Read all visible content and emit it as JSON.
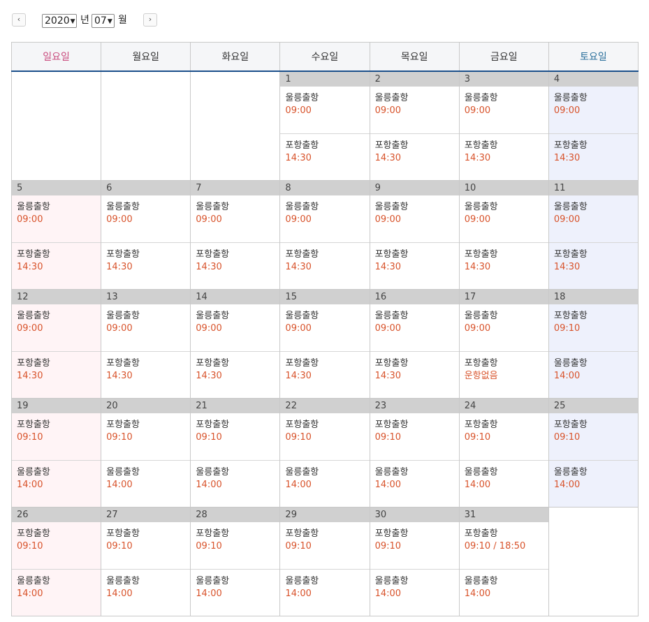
{
  "toolbar": {
    "prev_label": "‹",
    "next_label": "›",
    "year_value": "2020",
    "year_unit": "년",
    "month_value": "07",
    "month_unit": "월"
  },
  "weekdays": [
    "일요일",
    "월요일",
    "화요일",
    "수요일",
    "목요일",
    "금요일",
    "토요일"
  ],
  "colors": {
    "sunday_text": "#c94b7d",
    "saturday_text": "#2a6f9b",
    "time_text": "#d8532b",
    "header_underline": "#1b4f8a",
    "day_bar": "#d0d0d0",
    "sunday_bg": "#fff4f6",
    "saturday_bg": "#eef1fc"
  },
  "weeks": [
    [
      null,
      null,
      null,
      {
        "day": "1",
        "slots": [
          {
            "route": "울릉출항",
            "time": "09:00"
          },
          {
            "route": "포항출항",
            "time": "14:30"
          }
        ]
      },
      {
        "day": "2",
        "slots": [
          {
            "route": "울릉출항",
            "time": "09:00"
          },
          {
            "route": "포항출항",
            "time": "14:30"
          }
        ]
      },
      {
        "day": "3",
        "slots": [
          {
            "route": "울릉출항",
            "time": "09:00"
          },
          {
            "route": "포항출항",
            "time": "14:30"
          }
        ]
      },
      {
        "day": "4",
        "slots": [
          {
            "route": "울릉출항",
            "time": "09:00"
          },
          {
            "route": "포항출항",
            "time": "14:30"
          }
        ]
      }
    ],
    [
      {
        "day": "5",
        "slots": [
          {
            "route": "울릉출항",
            "time": "09:00"
          },
          {
            "route": "포항출항",
            "time": "14:30"
          }
        ]
      },
      {
        "day": "6",
        "slots": [
          {
            "route": "울릉출항",
            "time": "09:00"
          },
          {
            "route": "포항출항",
            "time": "14:30"
          }
        ]
      },
      {
        "day": "7",
        "slots": [
          {
            "route": "울릉출항",
            "time": "09:00"
          },
          {
            "route": "포항출항",
            "time": "14:30"
          }
        ]
      },
      {
        "day": "8",
        "slots": [
          {
            "route": "울릉출항",
            "time": "09:00"
          },
          {
            "route": "포항출항",
            "time": "14:30"
          }
        ]
      },
      {
        "day": "9",
        "slots": [
          {
            "route": "울릉출항",
            "time": "09:00"
          },
          {
            "route": "포항출항",
            "time": "14:30"
          }
        ]
      },
      {
        "day": "10",
        "slots": [
          {
            "route": "울릉출항",
            "time": "09:00"
          },
          {
            "route": "포항출항",
            "time": "14:30"
          }
        ]
      },
      {
        "day": "11",
        "slots": [
          {
            "route": "울릉출항",
            "time": "09:00"
          },
          {
            "route": "포항출항",
            "time": "14:30"
          }
        ]
      }
    ],
    [
      {
        "day": "12",
        "slots": [
          {
            "route": "울릉출항",
            "time": "09:00"
          },
          {
            "route": "포항출항",
            "time": "14:30"
          }
        ]
      },
      {
        "day": "13",
        "slots": [
          {
            "route": "울릉출항",
            "time": "09:00"
          },
          {
            "route": "포항출항",
            "time": "14:30"
          }
        ]
      },
      {
        "day": "14",
        "slots": [
          {
            "route": "울릉출항",
            "time": "09:00"
          },
          {
            "route": "포항출항",
            "time": "14:30"
          }
        ]
      },
      {
        "day": "15",
        "slots": [
          {
            "route": "울릉출항",
            "time": "09:00"
          },
          {
            "route": "포항출항",
            "time": "14:30"
          }
        ]
      },
      {
        "day": "16",
        "slots": [
          {
            "route": "울릉출항",
            "time": "09:00"
          },
          {
            "route": "포항출항",
            "time": "14:30"
          }
        ]
      },
      {
        "day": "17",
        "slots": [
          {
            "route": "울릉출항",
            "time": "09:00"
          },
          {
            "route": "포항출항",
            "time": "운항없음"
          }
        ]
      },
      {
        "day": "18",
        "slots": [
          {
            "route": "포항출항",
            "time": "09:10"
          },
          {
            "route": "울릉출항",
            "time": "14:00"
          }
        ]
      }
    ],
    [
      {
        "day": "19",
        "slots": [
          {
            "route": "포항출항",
            "time": "09:10"
          },
          {
            "route": "울릉출항",
            "time": "14:00"
          }
        ]
      },
      {
        "day": "20",
        "slots": [
          {
            "route": "포항출항",
            "time": "09:10"
          },
          {
            "route": "울릉출항",
            "time": "14:00"
          }
        ]
      },
      {
        "day": "21",
        "slots": [
          {
            "route": "포항출항",
            "time": "09:10"
          },
          {
            "route": "울릉출항",
            "time": "14:00"
          }
        ]
      },
      {
        "day": "22",
        "slots": [
          {
            "route": "포항출항",
            "time": "09:10"
          },
          {
            "route": "울릉출항",
            "time": "14:00"
          }
        ]
      },
      {
        "day": "23",
        "slots": [
          {
            "route": "포항출항",
            "time": "09:10"
          },
          {
            "route": "울릉출항",
            "time": "14:00"
          }
        ]
      },
      {
        "day": "24",
        "slots": [
          {
            "route": "포항출항",
            "time": "09:10"
          },
          {
            "route": "울릉출항",
            "time": "14:00"
          }
        ]
      },
      {
        "day": "25",
        "slots": [
          {
            "route": "포항출항",
            "time": "09:10"
          },
          {
            "route": "울릉출항",
            "time": "14:00"
          }
        ]
      }
    ],
    [
      {
        "day": "26",
        "slots": [
          {
            "route": "포항출항",
            "time": "09:10"
          },
          {
            "route": "울릉출항",
            "time": "14:00"
          }
        ]
      },
      {
        "day": "27",
        "slots": [
          {
            "route": "포항출항",
            "time": "09:10"
          },
          {
            "route": "울릉출항",
            "time": "14:00"
          }
        ]
      },
      {
        "day": "28",
        "slots": [
          {
            "route": "포항출항",
            "time": "09:10"
          },
          {
            "route": "울릉출항",
            "time": "14:00"
          }
        ]
      },
      {
        "day": "29",
        "slots": [
          {
            "route": "포항출항",
            "time": "09:10"
          },
          {
            "route": "울릉출항",
            "time": "14:00"
          }
        ]
      },
      {
        "day": "30",
        "slots": [
          {
            "route": "포항출항",
            "time": "09:10"
          },
          {
            "route": "울릉출항",
            "time": "14:00"
          }
        ]
      },
      {
        "day": "31",
        "slots": [
          {
            "route": "포항출항",
            "time": "09:10 / 18:50"
          },
          {
            "route": "울릉출항",
            "time": "14:00"
          }
        ]
      },
      null
    ]
  ]
}
